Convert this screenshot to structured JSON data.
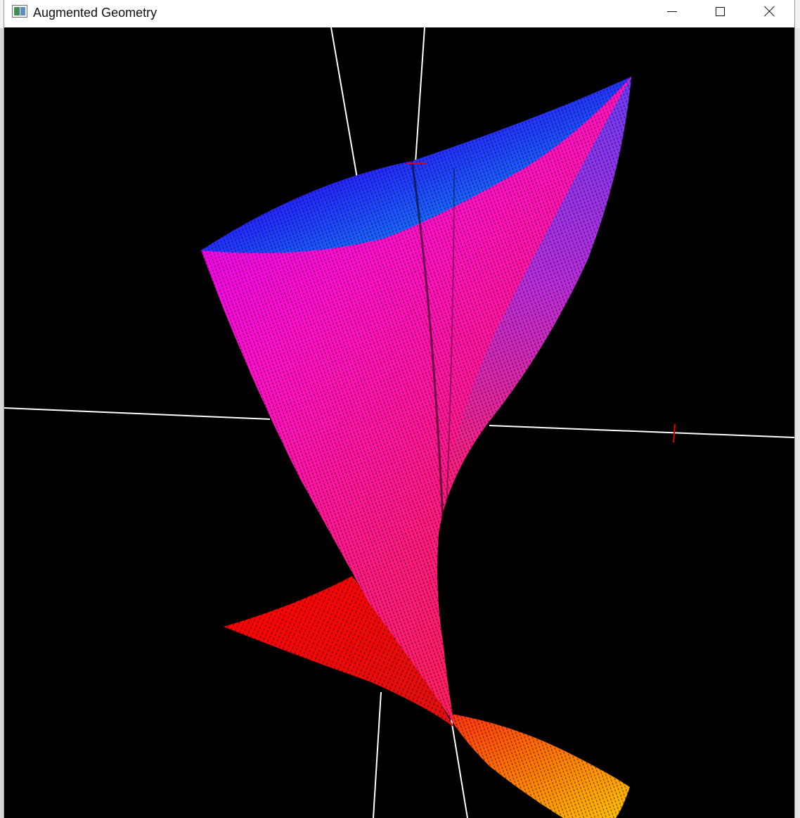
{
  "window": {
    "title": "Augmented Geometry",
    "icon": "app-window-icon",
    "controls": {
      "minimize": "minimize-icon",
      "maximize": "maximize-icon",
      "close": "close-icon"
    }
  },
  "scene": {
    "background": "#000000",
    "axis_color": "#ffffff",
    "tick_color": "#e00000",
    "surface_gradient": {
      "top_right": "#00d4ff",
      "top_mid": "#1a26ff",
      "mid_left": "#ff00ff",
      "center": "#ff1a8c",
      "lower": "#ff1a1a",
      "bottom": "#ffb000"
    }
  }
}
